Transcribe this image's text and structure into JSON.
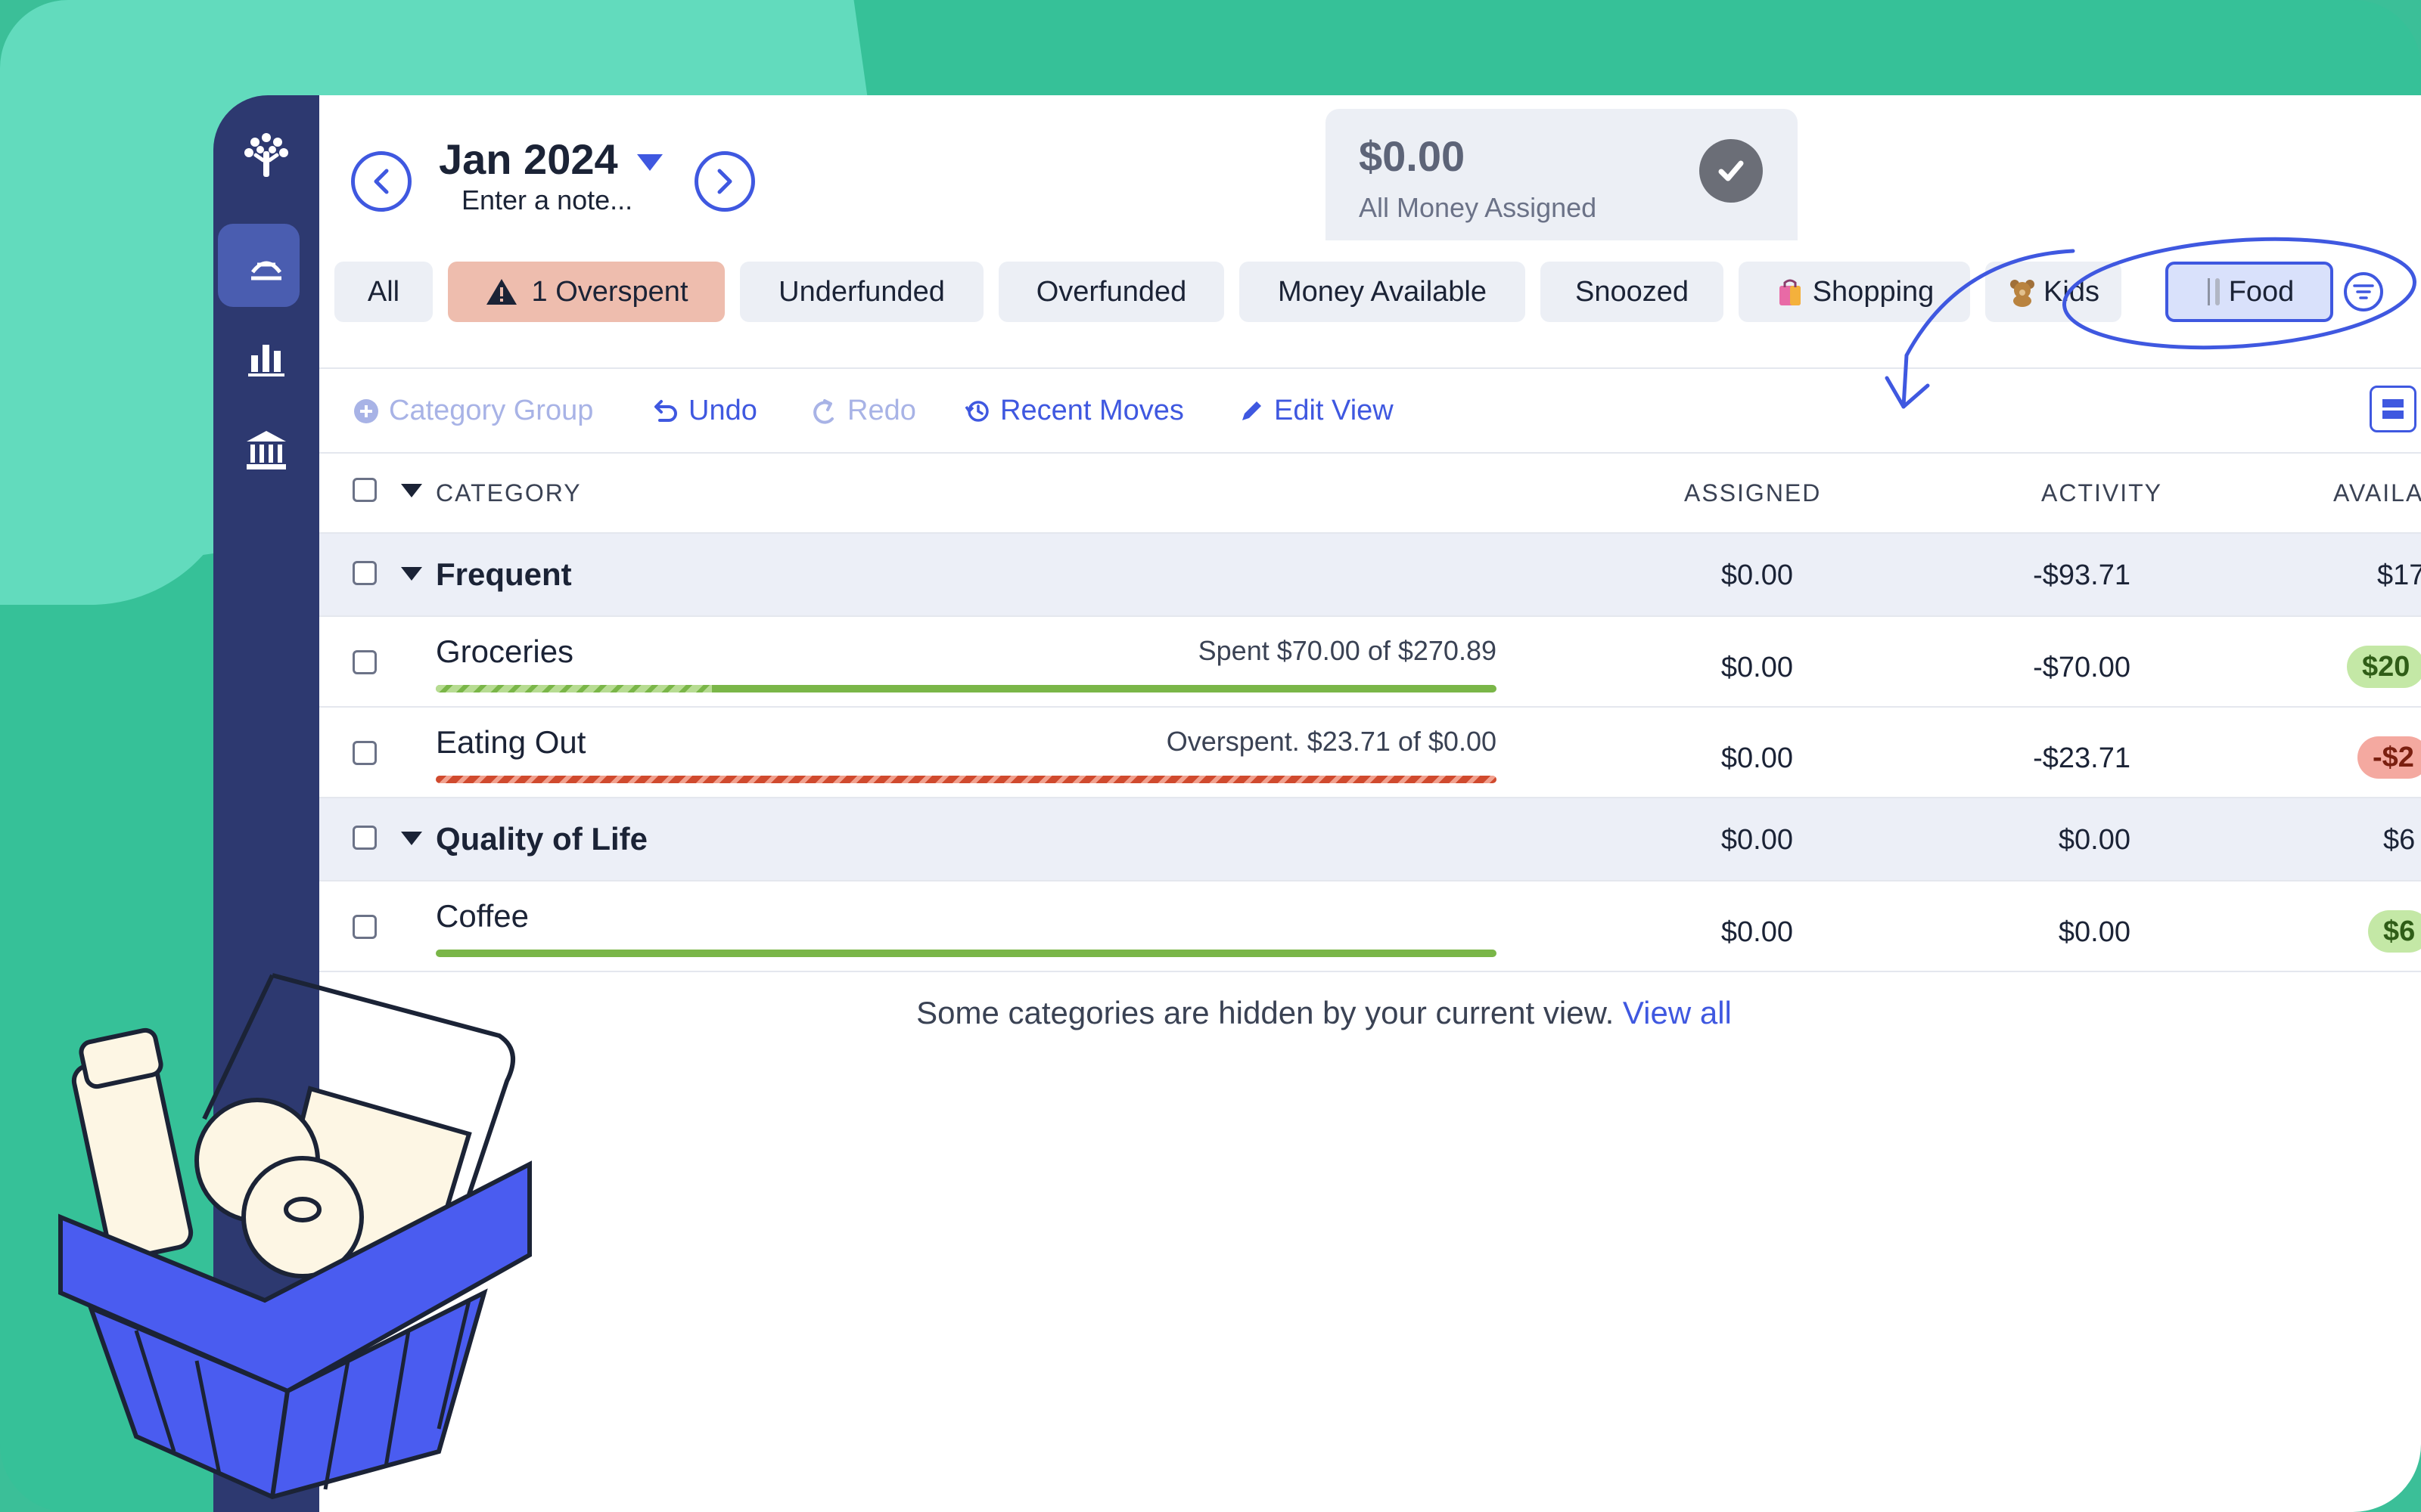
{
  "header": {
    "month": "Jan 2024",
    "note_placeholder": "Enter a note...",
    "assigned_amount": "$0.00",
    "assigned_label": "All Money Assigned"
  },
  "filters": [
    {
      "label": "All"
    },
    {
      "label": "1 Overspent"
    },
    {
      "label": "Underfunded"
    },
    {
      "label": "Overfunded"
    },
    {
      "label": "Money Available"
    },
    {
      "label": "Snoozed"
    },
    {
      "label": "Shopping"
    },
    {
      "label": "Kids"
    },
    {
      "label": "Food"
    }
  ],
  "toolbar": {
    "category_group": "Category Group",
    "undo": "Undo",
    "redo": "Redo",
    "recent_moves": "Recent Moves",
    "edit_view": "Edit View"
  },
  "columns": {
    "category": "CATEGORY",
    "assigned": "ASSIGNED",
    "activity": "ACTIVITY",
    "available": "AVAILA"
  },
  "groups": [
    {
      "name": "Frequent",
      "assigned": "$0.00",
      "activity": "-$93.71",
      "available": "$17",
      "categories": [
        {
          "name": "Groceries",
          "status": "Spent $70.00 of $270.89",
          "assigned": "$0.00",
          "activity": "-$70.00",
          "available": "$20",
          "spent_fraction": 0.26
        },
        {
          "name": "Eating Out",
          "status": "Overspent. $23.71 of $0.00",
          "assigned": "$0.00",
          "activity": "-$23.71",
          "available": "-$2",
          "spent_fraction": 1.0
        }
      ]
    },
    {
      "name": "Quality of Life",
      "assigned": "$0.00",
      "activity": "$0.00",
      "available": "$6",
      "categories": [
        {
          "name": "Coffee",
          "status": "",
          "assigned": "$0.00",
          "activity": "$0.00",
          "available": "$6",
          "spent_fraction": 0.0
        }
      ]
    }
  ],
  "footer": {
    "hidden_message": "Some categories are hidden by your current view.",
    "view_all": "View all"
  },
  "colors": {
    "accent": "#3f58e0",
    "sidebar": "#2d3970",
    "overspent": "#eebdae",
    "funded_green": "#7ab648",
    "overspent_red": "#d04a2e",
    "background": "#36c198"
  }
}
